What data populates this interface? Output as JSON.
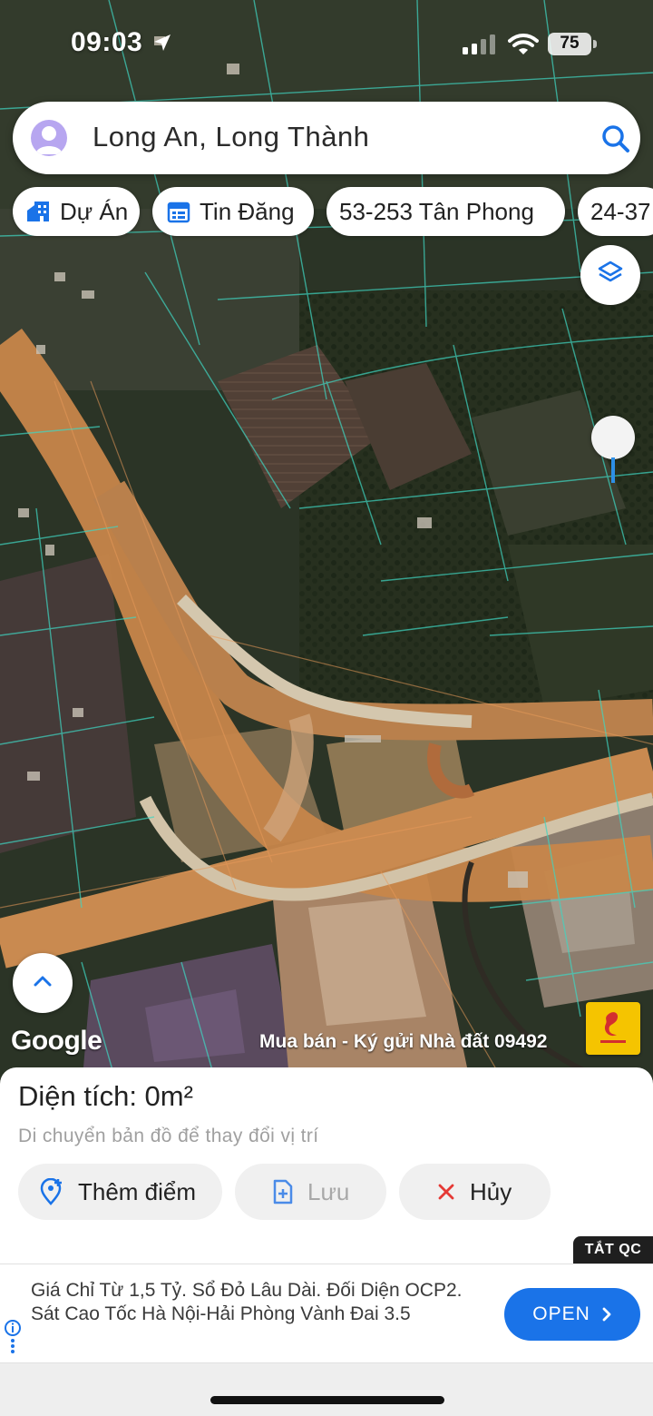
{
  "status_bar": {
    "time": "09:03",
    "battery": "75",
    "icons": [
      "location-arrow-icon",
      "cellular-signal-icon",
      "wifi-icon",
      "battery-icon"
    ]
  },
  "search": {
    "query": "Long An, Long Thành",
    "avatar_icon": "user-avatar-icon",
    "search_icon": "search-icon"
  },
  "chips": [
    {
      "label": "Dự Án",
      "icon": "building-icon"
    },
    {
      "label": "Tin Đăng",
      "icon": "listing-icon"
    },
    {
      "label": "53-253 Tân Phong"
    },
    {
      "label": "24-37"
    }
  ],
  "map": {
    "layers_icon": "layers-icon",
    "expand_icon": "chevron-up-icon",
    "attribution": "Google",
    "watermark": "Mua bán - Ký gửi Nhà đất 09492",
    "logo_icon": "pivland-logo-icon",
    "colors": {
      "parcel_lines": "#3fd6c2",
      "road": "#c8874a",
      "vegetation": "#2a3524"
    }
  },
  "sheet": {
    "area_label": "Diện tích: 0m²",
    "hint": "Di chuyển bản đồ để thay đổi vị trí",
    "buttons": {
      "add_point": "Thêm điểm",
      "save": "Lưu",
      "cancel": "Hủy"
    },
    "accent_color": "#1a73e8",
    "cancel_color": "#e53935"
  },
  "ad": {
    "close_label": "TẮT QC",
    "text": "Giá Chỉ Từ 1,5 Tỷ. Sổ Đỏ Lâu Dài. Đối Diện OCP2. Sát Cao Tốc Hà Nội-Hải Phòng Vành Đai 3.5",
    "cta": "OPEN"
  }
}
